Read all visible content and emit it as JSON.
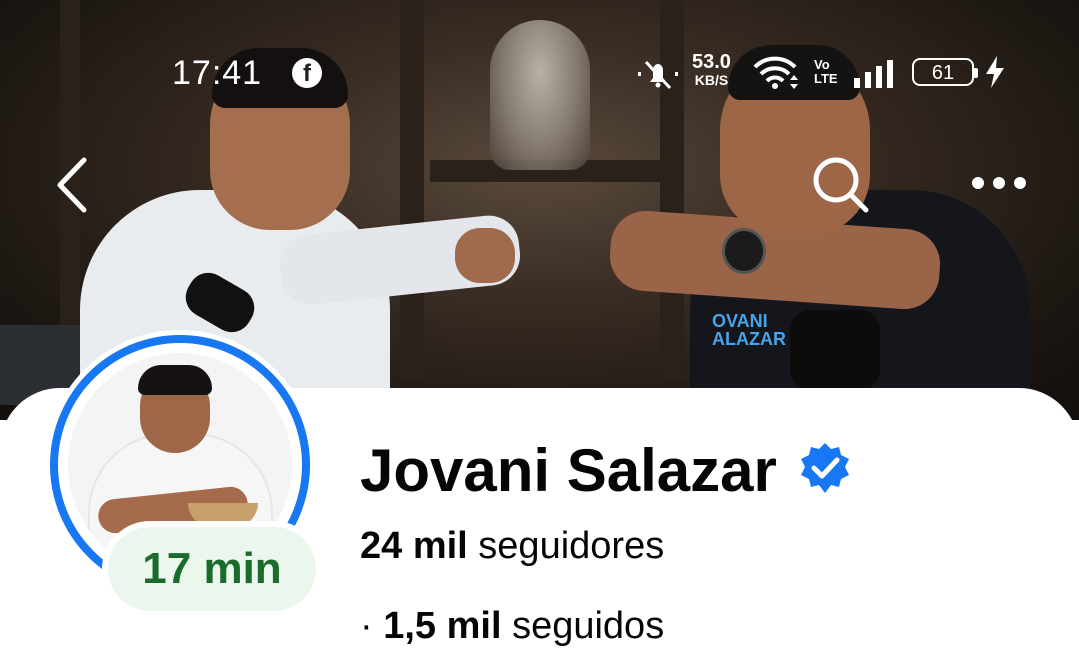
{
  "status_bar": {
    "time": "17:41",
    "app_notification_icon": "facebook-icon",
    "network_speed_value": "53.0",
    "network_speed_unit": "KB/S",
    "volte_top": "Vo",
    "volte_bottom": "LTE",
    "battery_level": "61",
    "icons": [
      "mute-bell-icon",
      "wifi-icon",
      "signal-icon",
      "battery-icon",
      "charging-bolt-icon"
    ]
  },
  "nav": {
    "back_icon": "chevron-left-icon",
    "search_icon": "search-icon",
    "more_icon": "more-dots-icon"
  },
  "cover": {
    "shirt_text_line1": "OVANI",
    "shirt_text_line2": "ALAZAR"
  },
  "profile": {
    "name": "Jovani Salazar",
    "verified": true,
    "story_badge": "17 min",
    "followers_count": "24 mil",
    "followers_label": "seguidores",
    "following_prefix": "·",
    "following_count": "1,5 mil",
    "following_label": "seguidos"
  },
  "colors": {
    "accent_blue": "#1877f2",
    "story_badge_bg": "#ebf7ec",
    "story_badge_text": "#1b6b2c",
    "text_primary": "#050505"
  }
}
